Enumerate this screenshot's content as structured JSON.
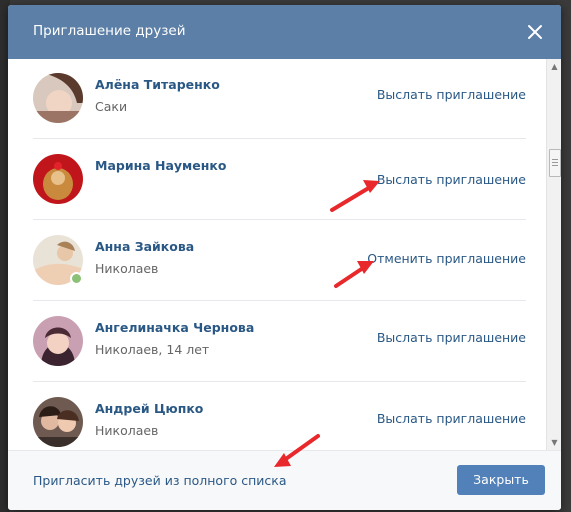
{
  "dialog": {
    "title": "Приглашение друзей",
    "close_icon": "close-icon"
  },
  "friends": [
    {
      "name": "Алёна Титаренко",
      "subtitle": "Саки",
      "action": "Выслать приглашение",
      "online": false
    },
    {
      "name": "Марина Науменко",
      "subtitle": "",
      "action": "Выслать приглашение",
      "online": false
    },
    {
      "name": "Анна Зайкова",
      "subtitle": "Николаев",
      "action": "Отменить приглашение",
      "online": true
    },
    {
      "name": "Ангелиначка Чернова",
      "subtitle": "Николаев, 14 лет",
      "action": "Выслать приглашение",
      "online": false
    },
    {
      "name": "Андрей Цюпко",
      "subtitle": "Николаев",
      "action": "Выслать приглашение",
      "online": false
    }
  ],
  "footer": {
    "invite_all_label": "Пригласить друзей из полного списка",
    "close_label": "Закрыть"
  },
  "colors": {
    "header": "#5b7fa6",
    "link": "#2a5885",
    "primary_button": "#5181b8",
    "annotation_arrow": "#e8282b",
    "online_dot": "#8ac176"
  }
}
